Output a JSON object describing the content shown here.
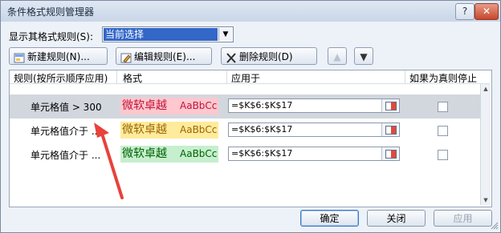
{
  "window": {
    "title": "条件格式规则管理器",
    "help": "?",
    "close": "✕"
  },
  "show_rules": {
    "label": "显示其格式规则(S):",
    "selected": "当前选择"
  },
  "toolbar": {
    "new_rule": "新建规则(N)...",
    "edit_rule": "编辑规则(E)...",
    "delete_rule": "删除规则(D)",
    "move_up": "▲",
    "move_down": "▼"
  },
  "columns": [
    "规则(按所示顺序应用)",
    "格式",
    "应用于",
    "如果为真则停止"
  ],
  "rules": [
    {
      "rule": "单元格值 > 300",
      "sample_cn": "微软卓越",
      "sample_en": "AaBbCc",
      "bg": "#ffc7ce",
      "fg": "#c0143c",
      "applies_to": "=$K$6:$K$17",
      "stop": false,
      "selected": true
    },
    {
      "rule": "单元格值介于 ...",
      "sample_cn": "微软卓越",
      "sample_en": "AaBbCc",
      "bg": "#ffeb9c",
      "fg": "#9c6500",
      "applies_to": "=$K$6:$K$17",
      "stop": false,
      "selected": false
    },
    {
      "rule": "单元格值介于 ...",
      "sample_cn": "微软卓越",
      "sample_en": "AaBbCc",
      "bg": "#c6efce",
      "fg": "#006100",
      "applies_to": "=$K$6:$K$17",
      "stop": false,
      "selected": false
    }
  ],
  "footer": {
    "ok": "确定",
    "cancel": "关闭",
    "apply": "应用"
  },
  "annotation_color": "#e8423b"
}
